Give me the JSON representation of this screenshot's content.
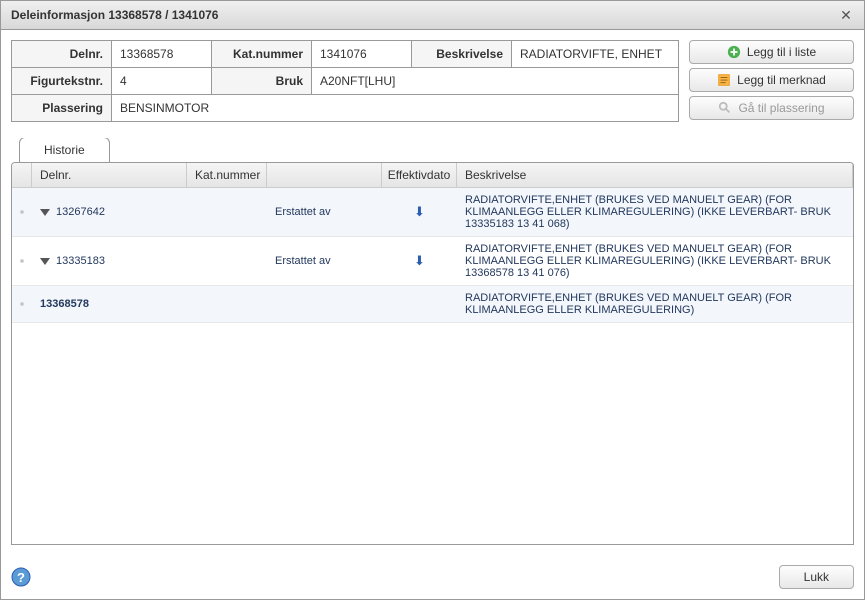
{
  "title": "Deleinformasjon 13368578 / 1341076",
  "info": {
    "labels": {
      "delnr": "Delnr.",
      "katnummer": "Kat.nummer",
      "beskrivelse": "Beskrivelse",
      "figurtekstnr": "Figurtekstnr.",
      "bruk": "Bruk",
      "plassering": "Plassering"
    },
    "values": {
      "delnr": "13368578",
      "katnummer": "1341076",
      "beskrivelse": "RADIATORVIFTE, ENHET",
      "figurtekstnr": "4",
      "bruk": "A20NFT[LHU]",
      "plassering": "BENSINMOTOR"
    }
  },
  "buttons": {
    "add_to_list": "Legg til i liste",
    "add_note": "Legg til merknad",
    "goto_placement": "Gå til plassering",
    "close": "Lukk"
  },
  "tab": {
    "history": "Historie"
  },
  "grid": {
    "headers": {
      "delnr": "Delnr.",
      "katnummer": "Kat.nummer",
      "effektivdato": "Effektivdato",
      "beskrivelse": "Beskrivelse"
    },
    "rows": [
      {
        "indent": 0,
        "hasTri": true,
        "hasArrow": true,
        "delnr": "13267642",
        "erst": "Erstattet av",
        "besk": "RADIATORVIFTE,ENHET (BRUKES VED MANUELT GEAR) (FOR KLIMAANLEGG ELLER KLIMAREGULERING) (IKKE LEVERBART- BRUK 13335183  13 41 068)",
        "bold": false
      },
      {
        "indent": 1,
        "hasTri": true,
        "hasArrow": true,
        "delnr": "13335183",
        "erst": "Erstattet av",
        "besk": "RADIATORVIFTE,ENHET (BRUKES VED MANUELT GEAR) (FOR KLIMAANLEGG ELLER KLIMAREGULERING) (IKKE LEVERBART- BRUK 13368578  13 41 076)",
        "bold": false
      },
      {
        "indent": 2,
        "hasTri": false,
        "hasArrow": false,
        "delnr": "13368578",
        "erst": "",
        "besk": "RADIATORVIFTE,ENHET (BRUKES VED MANUELT GEAR) (FOR KLIMAANLEGG ELLER KLIMAREGULERING)",
        "bold": true
      }
    ]
  }
}
